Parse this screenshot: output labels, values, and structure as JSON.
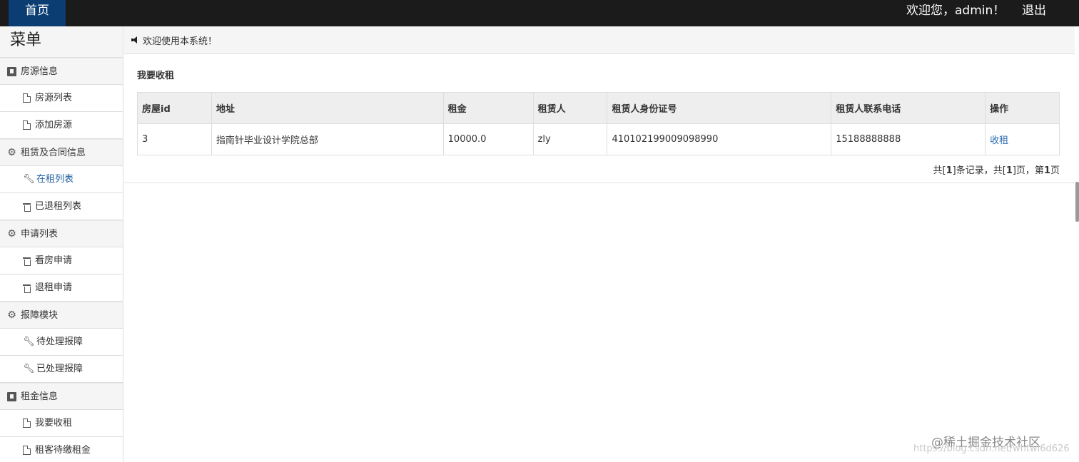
{
  "topbar": {
    "home_label": "首页",
    "welcome_text": "欢迎您，admin！",
    "logout_label": "退出"
  },
  "sidebar": {
    "title": "菜单",
    "groups": [
      {
        "label": "房源信息",
        "icon": "book-icon",
        "items": [
          {
            "label": "房源列表",
            "icon": "file-icon"
          },
          {
            "label": "添加房源",
            "icon": "file-icon"
          }
        ]
      },
      {
        "label": "租赁及合同信息",
        "icon": "gear-icon",
        "items": [
          {
            "label": "在租列表",
            "icon": "wrench-icon",
            "active": true
          },
          {
            "label": "已退租列表",
            "icon": "trash-icon"
          }
        ]
      },
      {
        "label": "申请列表",
        "icon": "gear-icon",
        "items": [
          {
            "label": "看房申请",
            "icon": "trash-icon"
          },
          {
            "label": "退租申请",
            "icon": "trash-icon"
          }
        ]
      },
      {
        "label": "报障模块",
        "icon": "gear-icon",
        "items": [
          {
            "label": "待处理报障",
            "icon": "wrench-icon"
          },
          {
            "label": "已处理报障",
            "icon": "wrench-icon"
          }
        ]
      },
      {
        "label": "租金信息",
        "icon": "book-icon",
        "items": [
          {
            "label": "我要收租",
            "icon": "file-icon"
          },
          {
            "label": "租客待缴租金",
            "icon": "file-icon"
          }
        ]
      }
    ]
  },
  "notice": {
    "icon": "speaker-icon",
    "text": "欢迎使用本系统！"
  },
  "panel": {
    "title": "我要收租",
    "table": {
      "headers": [
        "房屋id",
        "地址",
        "租金",
        "租赁人",
        "租赁人身份证号",
        "租赁人联系电话",
        "操作"
      ],
      "rows": [
        [
          "3",
          "指南针毕业设计学院总部",
          "10000.0",
          "zly",
          "410102199009098990",
          "15188888888",
          "收租"
        ]
      ]
    },
    "pager": {
      "p1": "共[",
      "records": "1",
      "p2": "]条记录，共[",
      "pages": "1",
      "p3": "]页，第",
      "current": "1",
      "p4": "页"
    }
  },
  "watermark": {
    "text": "@稀土掘金技术社区",
    "url": "https://blog.csdn.net/whtwl6d626"
  },
  "colors": {
    "topbar_bg": "#1b1b1b",
    "home_tab_bg": "#0b3d73",
    "link": "#2a6ab3"
  }
}
